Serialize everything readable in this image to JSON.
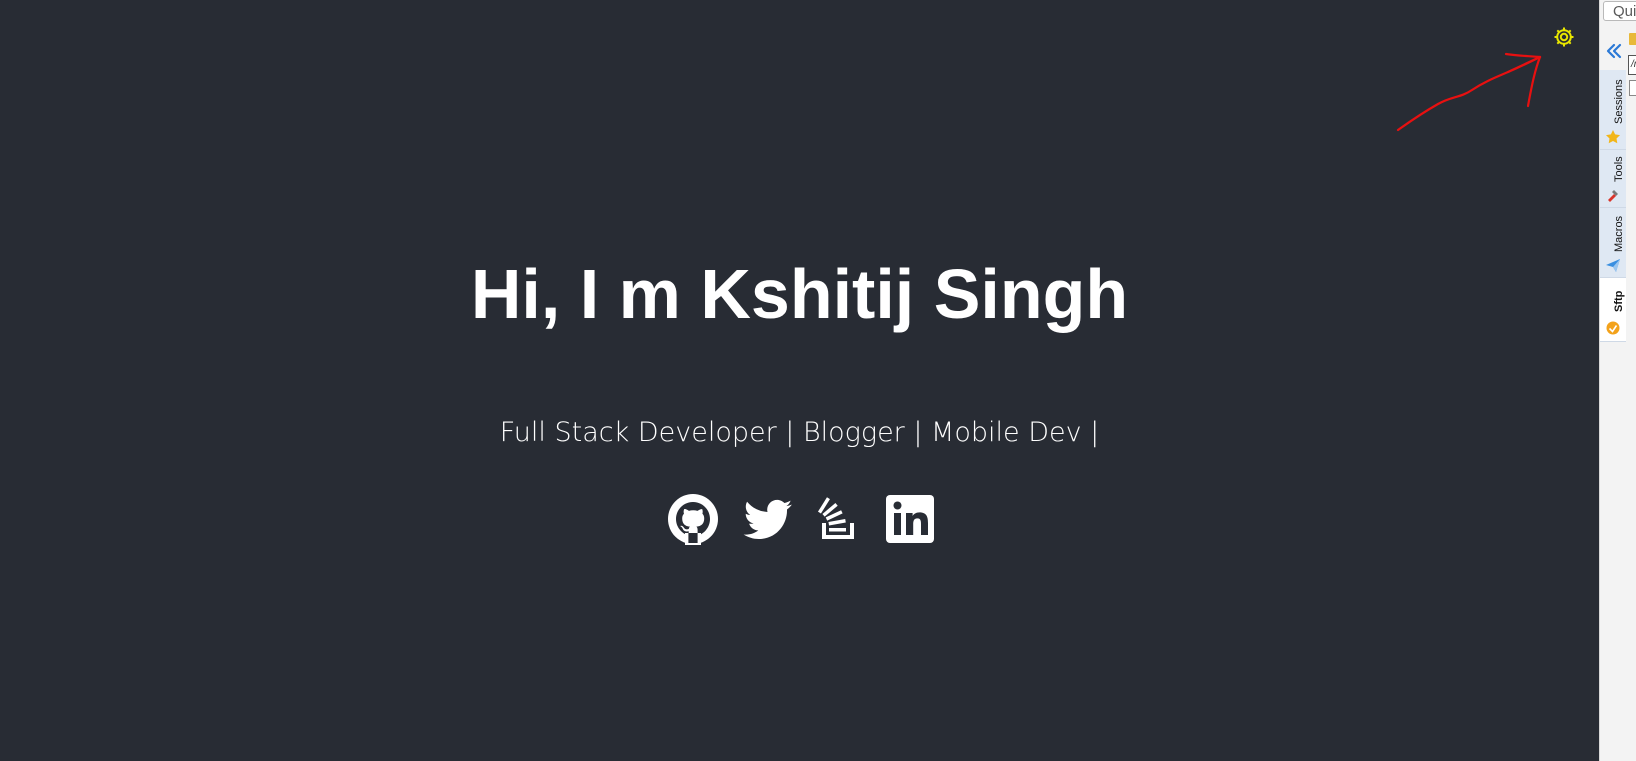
{
  "page": {
    "headline": "Hi, I m Kshitij Singh",
    "subtitle": "Full Stack Developer | Blogger | Mobile Dev |",
    "background_color": "#282c34",
    "text_color": "#ffffff",
    "theme_toggle_icon": "gear-icon",
    "theme_toggle_color": "#e8e600",
    "social_links": [
      {
        "name": "github",
        "icon": "github-icon"
      },
      {
        "name": "twitter",
        "icon": "twitter-icon"
      },
      {
        "name": "stackoverflow",
        "icon": "stackoverflow-icon"
      },
      {
        "name": "linkedin",
        "icon": "linkedin-icon"
      }
    ],
    "annotation": {
      "icon": "arrow-annotation",
      "color": "#e81010"
    }
  },
  "side_panel": {
    "quick_connect_placeholder": "Quick connect...",
    "collapse_icon": "double-chevron-left-icon",
    "path_value": "/r",
    "tabs": [
      {
        "label": "Sessions",
        "icon": "star-icon",
        "active": false
      },
      {
        "label": "Tools",
        "icon": "tools-icon",
        "active": false
      },
      {
        "label": "Macros",
        "icon": "paper-plane-icon",
        "active": false
      },
      {
        "label": "Sftp",
        "icon": "sftp-icon",
        "active": true
      }
    ]
  }
}
